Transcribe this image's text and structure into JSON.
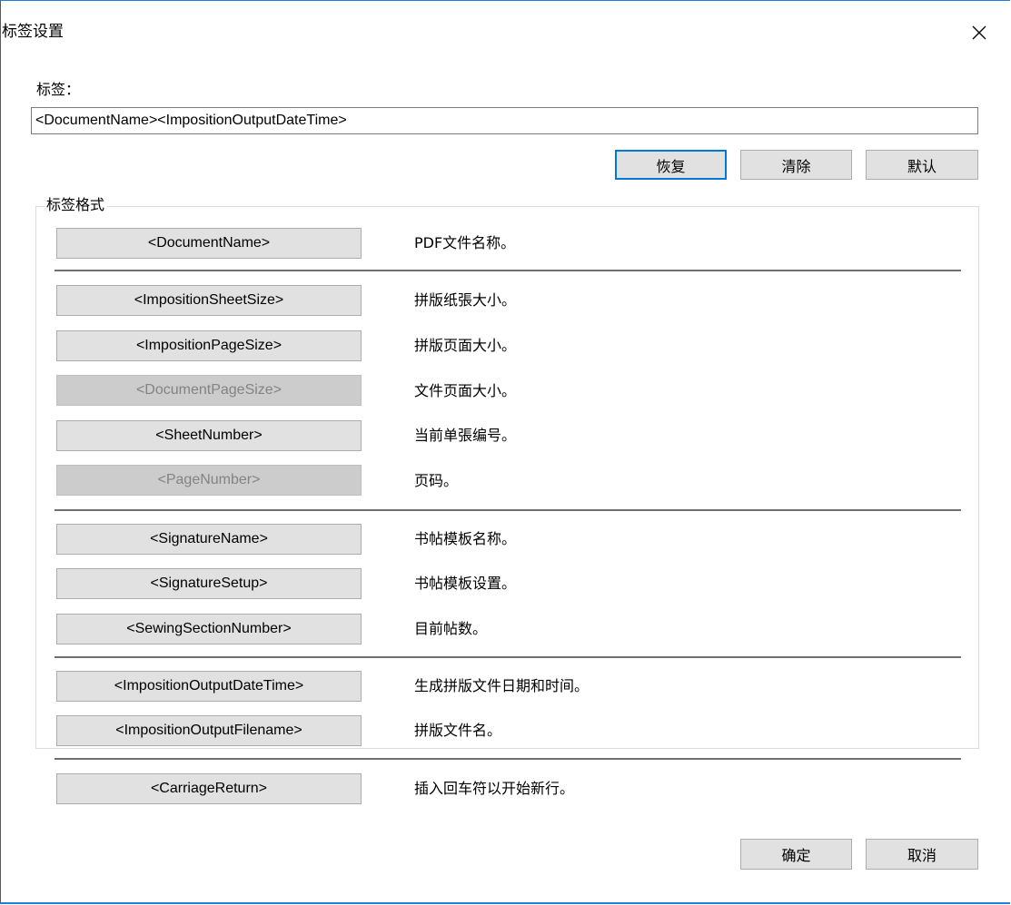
{
  "dialog": {
    "title": "标签设置",
    "close_glyph": "✕"
  },
  "label_field": {
    "caption": "标签：",
    "value": "<DocumentName><ImpositionOutputDateTime>"
  },
  "field_buttons": {
    "restore": "恢复",
    "clear": "清除",
    "default": "默认"
  },
  "tag_format": {
    "legend": "标签格式",
    "items": [
      {
        "tag": "<DocumentName>",
        "desc": "PDF文件名称。",
        "enabled": true
      },
      {
        "tag": "<ImpositionSheetSize>",
        "desc": "拼版纸張大小。",
        "enabled": true
      },
      {
        "tag": "<ImpositionPageSize>",
        "desc": "拼版页面大小。",
        "enabled": true
      },
      {
        "tag": "<DocumentPageSize>",
        "desc": "文件页面大小。",
        "enabled": false
      },
      {
        "tag": "<SheetNumber>",
        "desc": "当前单張编号。",
        "enabled": true
      },
      {
        "tag": "<PageNumber>",
        "desc": "页码。",
        "enabled": false
      },
      {
        "tag": "<SignatureName>",
        "desc": "书帖模板名称。",
        "enabled": true
      },
      {
        "tag": "<SignatureSetup>",
        "desc": "书帖模板设置。",
        "enabled": true
      },
      {
        "tag": "<SewingSectionNumber>",
        "desc": "目前帖数。",
        "enabled": true
      },
      {
        "tag": "<ImpositionOutputDateTime>",
        "desc": "生成拼版文件日期和时间。",
        "enabled": true
      },
      {
        "tag": "<ImpositionOutputFilename>",
        "desc": "拼版文件名。",
        "enabled": true
      },
      {
        "tag": "<CarriageReturn>",
        "desc": "插入回车符以开始新行。",
        "enabled": true
      }
    ]
  },
  "footer": {
    "ok": "确定",
    "cancel": "取消"
  },
  "colors": {
    "title_border": "#1e7fd6",
    "focus_border": "#0078d7",
    "button_face": "#e1e1e1",
    "disabled_face": "#cccccc",
    "disabled_text": "#838383"
  }
}
